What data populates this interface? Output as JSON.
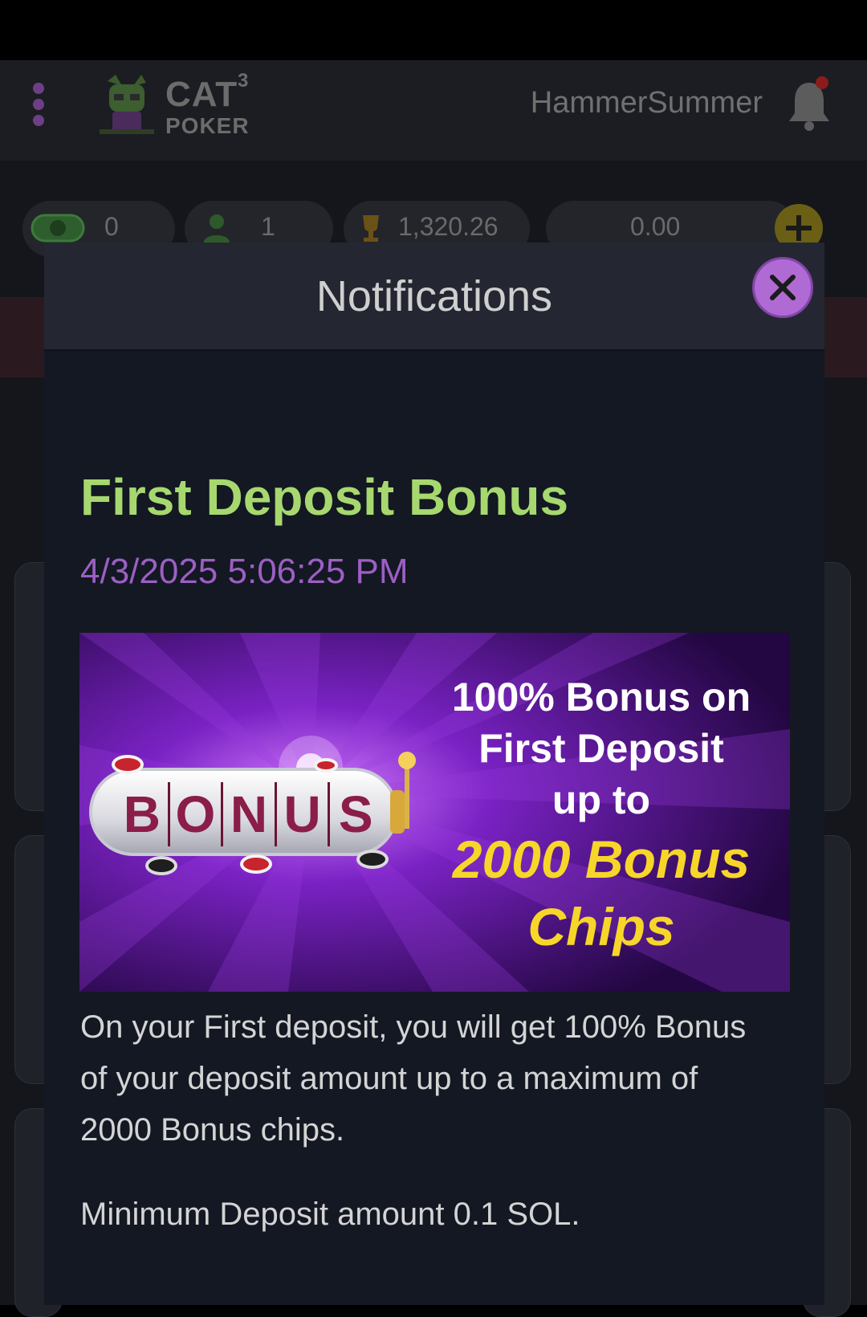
{
  "app": {
    "logo": {
      "title": "CAT",
      "superscript": "3",
      "subtitle": "POKER"
    },
    "username": "HammerSummer",
    "stats": {
      "cash_value": "0",
      "players_value": "1",
      "trophy_value": "1,320.26",
      "balance_value": "0.00"
    }
  },
  "modal": {
    "title": "Notifications",
    "notification": {
      "title": "First Deposit Bonus",
      "date": "4/3/2025 5:06:25 PM",
      "banner": {
        "reel_letters": [
          "B",
          "O",
          "N",
          "U",
          "S"
        ],
        "line1": "100% Bonus on",
        "line2": "First Deposit",
        "line3": "up to",
        "line4": "2000 Bonus",
        "line5": "Chips"
      },
      "body": "On your First deposit, you will get 100% Bonus of your deposit amount up to a maximum of 2000 Bonus chips.",
      "body2": "Minimum Deposit amount 0.1 SOL."
    }
  },
  "colors": {
    "accent_green": "#a7d86f",
    "accent_purple": "#9c5fc3",
    "close_button": "#b06ad4",
    "banner_yellow": "#f7d62a"
  }
}
